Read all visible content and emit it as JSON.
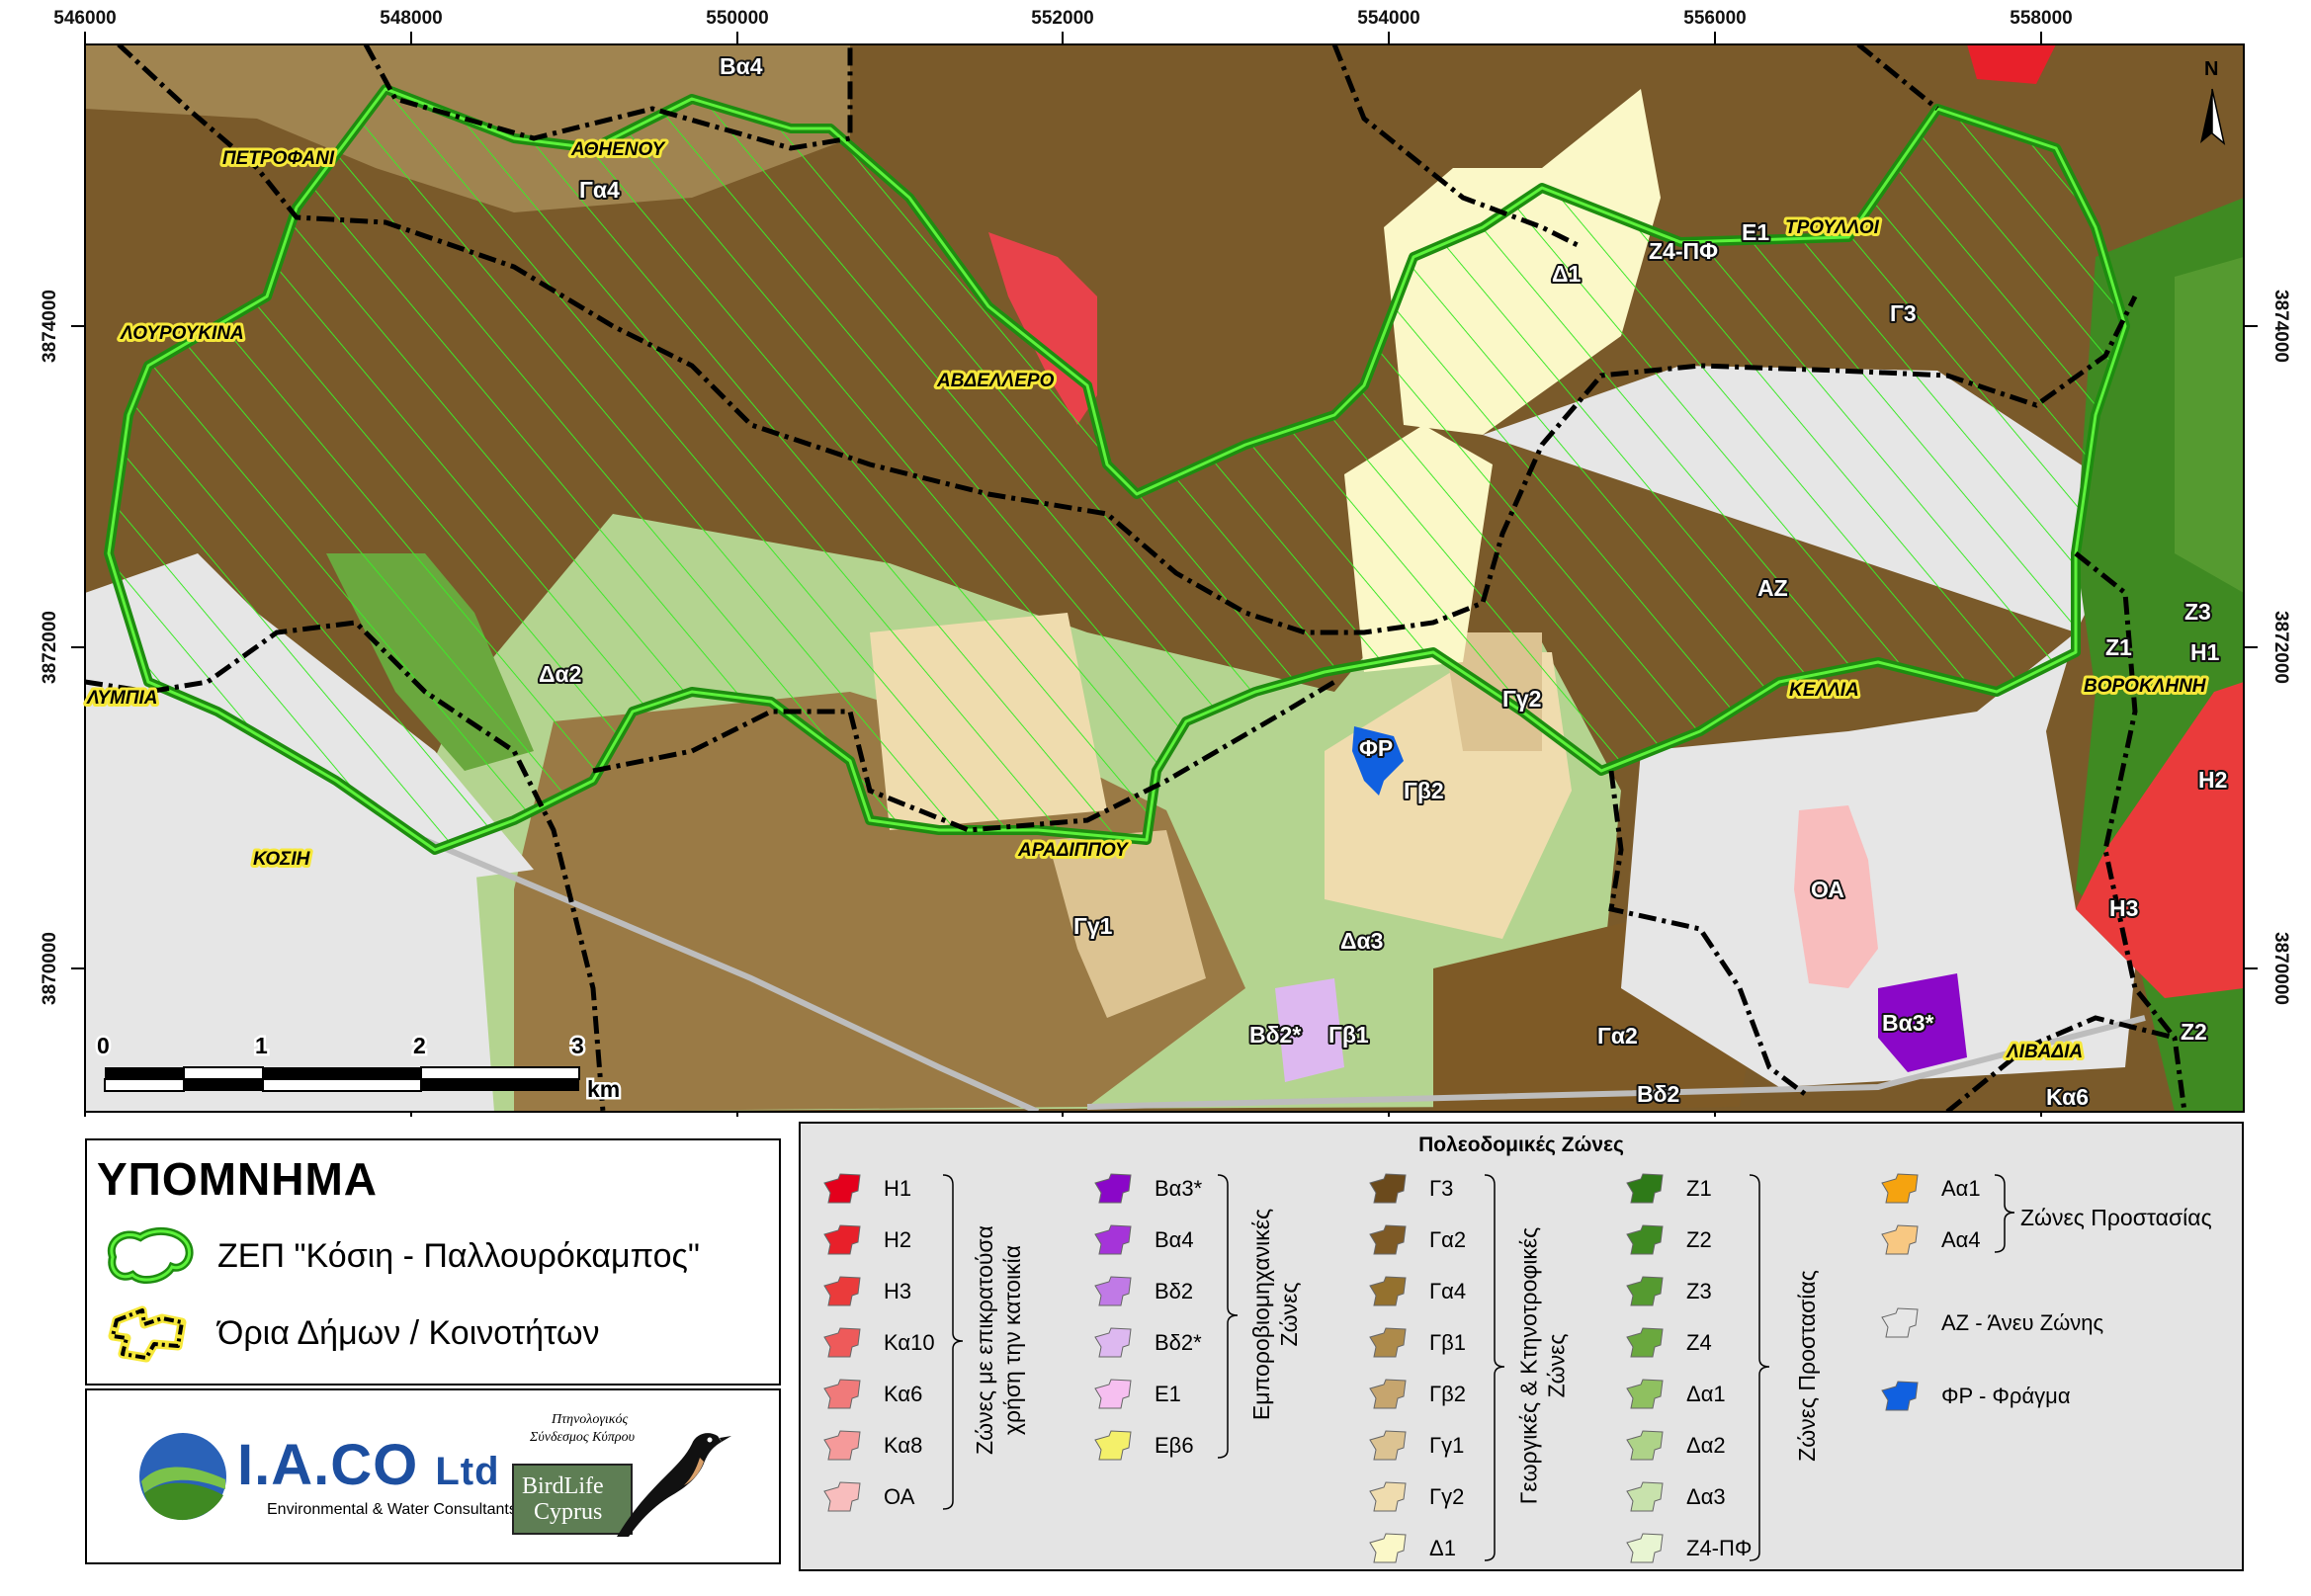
{
  "map": {
    "x_ticks": [
      "546000",
      "548000",
      "550000",
      "552000",
      "554000",
      "556000",
      "558000"
    ],
    "y_ticks": [
      "3874000",
      "3872000",
      "3870000"
    ],
    "north": "N",
    "places": [
      {
        "id": "petrofani",
        "label": "ΠΕΤΡΟΦΑΝΙ"
      },
      {
        "id": "athienou",
        "label": "ΑΘΗΕΝΟΥ"
      },
      {
        "id": "lourougina",
        "label": "ΛΟΥΡΟΥΚΙΝΑ"
      },
      {
        "id": "avdellero",
        "label": "ΑΒΔΕΛΛΕΡΟ"
      },
      {
        "id": "troulloi",
        "label": "ΤΡΟΥΛΛΟΙ"
      },
      {
        "id": "lympia",
        "label": "ΛΥΜΠΙΑ"
      },
      {
        "id": "kellia",
        "label": "ΚΕΛΛΙΑ"
      },
      {
        "id": "voroklini",
        "label": "ΒΟΡΟΚΛΗΝΗ"
      },
      {
        "id": "kosi",
        "label": "ΚΟΣΙΗ"
      },
      {
        "id": "aradippou",
        "label": "ΑΡΑΔΙΠΠΟΥ"
      },
      {
        "id": "livadia",
        "label": "ΛΙΒΑΔΙΑ"
      }
    ],
    "zone_labels": [
      "Βα4",
      "Γα4",
      "Δ1",
      "Ζ4-ΠΦ",
      "Ε1",
      "Γ3",
      "ΑΖ",
      "Ζ3",
      "Ζ1",
      "Η1",
      "Δα2",
      "Γγ2",
      "ΦΡ",
      "Γβ2",
      "Η2",
      "ΟΑ",
      "Η3",
      "Γγ1",
      "Δα3",
      "Βδ2*",
      "Γβ1",
      "Γα2",
      "Βα3*",
      "Ζ2",
      "Βδ2",
      "Κα6"
    ],
    "scale": {
      "ticks": [
        "0",
        "1",
        "2",
        "3"
      ],
      "unit": "km"
    }
  },
  "legend": {
    "title": "ΥΠΟΜΝΗΜΑ",
    "items": [
      {
        "id": "zep",
        "label": "ΖΕΠ \"Κόσιη - Παλλουρόκαμπος\""
      },
      {
        "id": "boundaries",
        "label": "Όρια Δήμων / Κοινοτήτων"
      }
    ]
  },
  "logos": {
    "iaco_name": "I.A.CO",
    "iaco_suffix": "Ltd",
    "iaco_tag": "Environmental & Water Consultants",
    "birdlife_greek_1": "Πτηνολογικός",
    "birdlife_greek_2": "Σύνδεσμος Κύπρου",
    "birdlife_name_1": "BirdLife",
    "birdlife_name_2": "Cyprus"
  },
  "zones": {
    "title": "Πολεοδομικές Ζώνες",
    "groups": [
      {
        "label_lines": [
          "Ζώνες με επικρατούσα",
          "χρήση την κατοικία"
        ],
        "items": [
          {
            "code": "Η1",
            "color": "#e4001c"
          },
          {
            "code": "Η2",
            "color": "#e8202a"
          },
          {
            "code": "Η3",
            "color": "#ea3b3b"
          },
          {
            "code": "Κα10",
            "color": "#ee5a5a"
          },
          {
            "code": "Κα6",
            "color": "#f07a7a"
          },
          {
            "code": "Κα8",
            "color": "#f59a9a"
          },
          {
            "code": "ΟΑ",
            "color": "#f8bdbd"
          }
        ]
      },
      {
        "label_lines": [
          "Εμπορoβιομηχανικές",
          "Ζώνες"
        ],
        "items": [
          {
            "code": "Βα3*",
            "color": "#8a07c8"
          },
          {
            "code": "Βα4",
            "color": "#a534d9"
          },
          {
            "code": "Βδ2",
            "color": "#c07ae6"
          },
          {
            "code": "Βδ2*",
            "color": "#ddb8f0"
          },
          {
            "code": "Ε1",
            "color": "#f6bff0"
          },
          {
            "code": "Εβ6",
            "color": "#f4f06a"
          }
        ]
      },
      {
        "label_lines": [
          "Γεωργικές & Κτηνοτροφικές",
          "Ζώνες"
        ],
        "items": [
          {
            "code": "Γ3",
            "color": "#6b4a1c"
          },
          {
            "code": "Γα2",
            "color": "#7e5a26"
          },
          {
            "code": "Γα4",
            "color": "#94712e"
          },
          {
            "code": "Γβ1",
            "color": "#ad8a4a"
          },
          {
            "code": "Γβ2",
            "color": "#c6a56e"
          },
          {
            "code": "Γγ1",
            "color": "#dcc392"
          },
          {
            "code": "Γγ2",
            "color": "#efdcae"
          },
          {
            "code": "Δ1",
            "color": "#fbf8c8"
          }
        ]
      },
      {
        "label_lines": [
          "Ζώνες Προστασίας"
        ],
        "items": [
          {
            "code": "Ζ1",
            "color": "#2e7a18"
          },
          {
            "code": "Ζ2",
            "color": "#3f8a22"
          },
          {
            "code": "Ζ3",
            "color": "#559a30"
          },
          {
            "code": "Ζ4",
            "color": "#6aa83e"
          },
          {
            "code": "Δα1",
            "color": "#8fc060"
          },
          {
            "code": "Δα2",
            "color": "#aed388"
          },
          {
            "code": "Δα3",
            "color": "#c8e2ac"
          },
          {
            "code": "Ζ4-ΠΦ",
            "color": "#e8f5d2"
          }
        ]
      }
    ],
    "protection": {
      "label": "Ζώνες Προστασίας",
      "items": [
        {
          "code": "Αα1",
          "color": "#f5a30f"
        },
        {
          "code": "Αα4",
          "color": "#f8c882"
        }
      ]
    },
    "az": {
      "label": "ΑΖ - Άνευ Ζώνης",
      "color": "#e6e6e6"
    },
    "fr": {
      "label": "ΦΡ - Φράγμα",
      "color": "#1060e0"
    }
  }
}
